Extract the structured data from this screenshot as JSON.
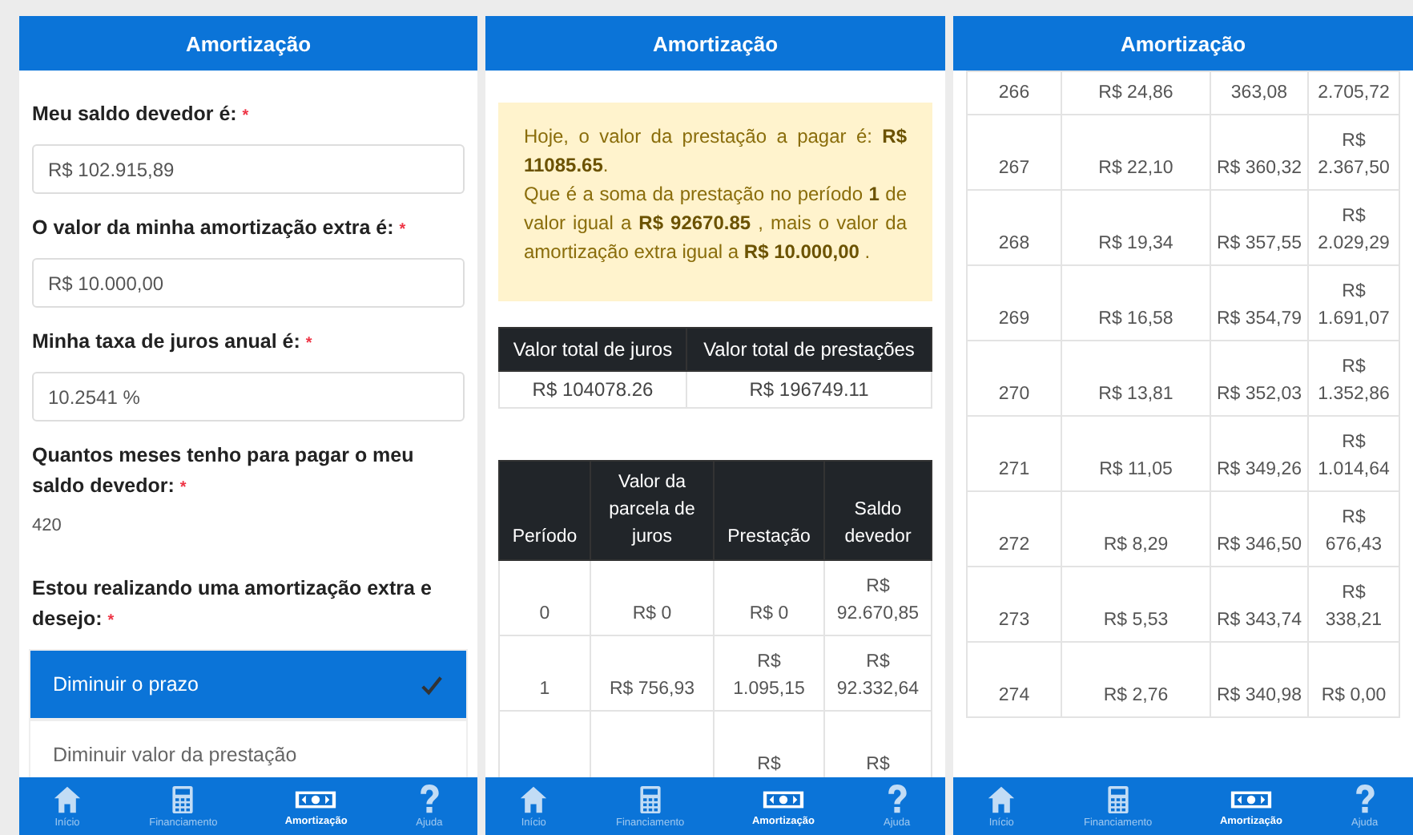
{
  "screens": [
    {
      "kind": "form",
      "title": "Amortização",
      "fields": [
        {
          "label": "Meu saldo devedor é:",
          "required_mark": "*",
          "value": "R$ 102.915,89",
          "kind": "input"
        },
        {
          "label": "O valor da minha amortização extra é:",
          "required_mark": "*",
          "value": "R$ 10.000,00",
          "kind": "input"
        },
        {
          "label": "Minha taxa de juros anual é:",
          "required_mark": "*",
          "value": "10.2541 %",
          "kind": "input"
        },
        {
          "label": "Quantos meses tenho para pagar o meu saldo devedor:",
          "required_mark": "*",
          "value": "420",
          "kind": "text"
        }
      ],
      "choice": {
        "label": "Estou realizando uma amortização extra e desejo:",
        "required_mark": "*",
        "options": [
          {
            "label": "Diminuir o prazo",
            "selected": true
          },
          {
            "label": "Diminuir valor da prestação",
            "selected": false
          }
        ]
      },
      "nav": [
        {
          "label": "Início",
          "kind": "home",
          "selected": false
        },
        {
          "label": "Financiamento",
          "kind": "calc",
          "selected": false
        },
        {
          "label": "Amortização",
          "kind": "money",
          "selected": true
        },
        {
          "label": "Ajuda",
          "kind": "help",
          "selected": false
        }
      ]
    },
    {
      "kind": "result",
      "title": "Amortização",
      "alert": [
        "Hoje, o valor da prestação a pagar é: **R$ 11085.65**.",
        "Que é a soma da prestação no período **1** de valor igual a **R$ 92670.85** , mais o valor da amortização extra igual a **R$ 10.000,00** ."
      ],
      "summary": {
        "columns": [
          "Valor total de juros",
          "Valor total de prestações"
        ],
        "row": [
          "R$ 104078.26",
          "R$ 196749.11"
        ]
      },
      "table": {
        "columns": [
          "Período",
          "Valor da parcela de juros",
          "Prestação",
          "Saldo devedor"
        ],
        "rows": [
          {
            "periodo": "0",
            "juros": "R$ 0",
            "prestacao": "R$ 0",
            "saldo": "R$ 92.670,85"
          },
          {
            "periodo": "1",
            "juros": "R$ 756,93",
            "prestacao": "R$ 1.095,15",
            "saldo": "R$ 92.332,64"
          },
          {
            "prestacao": "R$",
            "saldo": "R$"
          }
        ]
      },
      "nav": [
        {
          "label": "Início",
          "kind": "home",
          "selected": false
        },
        {
          "label": "Financiamento",
          "kind": "calc",
          "selected": false
        },
        {
          "label": "Amortização",
          "kind": "money",
          "selected": true
        },
        {
          "label": "Ajuda",
          "kind": "help",
          "selected": false
        }
      ]
    },
    {
      "kind": "table",
      "title": "Amortização",
      "table": {
        "rows": [
          {
            "periodo": "266",
            "juros": "R$ 24,86",
            "prestacao": "363,08",
            "saldo": "2.705,72"
          },
          {
            "periodo": "267",
            "juros": "R$ 22,10",
            "prestacao": "R$ 360,32",
            "saldo": "R$ 2.367,50"
          },
          {
            "periodo": "268",
            "juros": "R$ 19,34",
            "prestacao": "R$ 357,55",
            "saldo": "R$ 2.029,29"
          },
          {
            "periodo": "269",
            "juros": "R$ 16,58",
            "prestacao": "R$ 354,79",
            "saldo": "R$ 1.691,07"
          },
          {
            "periodo": "270",
            "juros": "R$ 13,81",
            "prestacao": "R$ 352,03",
            "saldo": "R$ 1.352,86"
          },
          {
            "periodo": "271",
            "juros": "R$ 11,05",
            "prestacao": "R$ 349,26",
            "saldo": "R$ 1.014,64"
          },
          {
            "periodo": "272",
            "juros": "R$ 8,29",
            "prestacao": "R$ 346,50",
            "saldo": "R$ 676,43"
          },
          {
            "periodo": "273",
            "juros": "R$ 5,53",
            "prestacao": "R$ 343,74",
            "saldo": "R$ 338,21"
          },
          {
            "periodo": "274",
            "juros": "R$ 2,76",
            "prestacao": "R$ 340,98",
            "saldo": "R$ 0,00"
          }
        ]
      },
      "nav": [
        {
          "label": "Início",
          "kind": "home",
          "selected": false
        },
        {
          "label": "Financiamento",
          "kind": "calc",
          "selected": false
        },
        {
          "label": "Amortização",
          "kind": "money",
          "selected": true
        },
        {
          "label": "Ajuda",
          "kind": "help",
          "selected": false
        }
      ]
    }
  ]
}
